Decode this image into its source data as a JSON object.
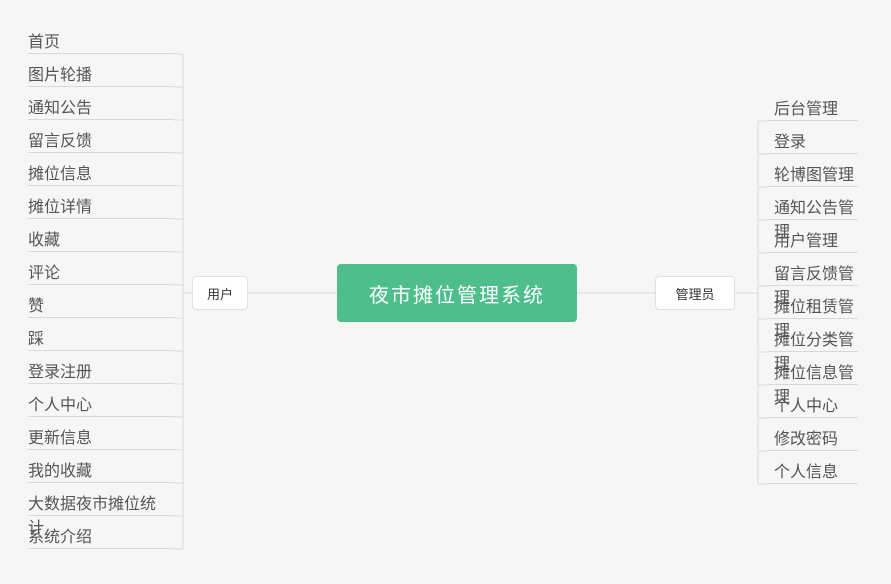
{
  "root": {
    "label": "夜市摊位管理系统"
  },
  "branches": {
    "left": {
      "label": "用户"
    },
    "right": {
      "label": "管理员"
    }
  },
  "leaves": {
    "left": [
      "首页",
      "图片轮播",
      "通知公告",
      "留言反馈",
      "摊位信息",
      "摊位详情",
      "收藏",
      "评论",
      "赞",
      "踩",
      "登录注册",
      "个人中心",
      "更新信息",
      "我的收藏",
      "大数据夜市摊位统计",
      "系统介绍"
    ],
    "right": [
      "后台管理",
      "登录",
      "轮博图管理",
      "通知公告管理",
      "用户管理",
      "留言反馈管理",
      "摊位租赁管理",
      "摊位分类管理",
      "摊位信息管理",
      "个人中心",
      "修改密码",
      "个人信息"
    ]
  },
  "chart_data": {
    "type": "mindmap",
    "root": "夜市摊位管理系统",
    "children": [
      {
        "label": "用户",
        "side": "left",
        "children": [
          "首页",
          "图片轮播",
          "通知公告",
          "留言反馈",
          "摊位信息",
          "摊位详情",
          "收藏",
          "评论",
          "赞",
          "踩",
          "登录注册",
          "个人中心",
          "更新信息",
          "我的收藏",
          "大数据夜市摊位统计",
          "系统介绍"
        ]
      },
      {
        "label": "管理员",
        "side": "right",
        "children": [
          "后台管理",
          "登录",
          "轮博图管理",
          "通知公告管理",
          "用户管理",
          "留言反馈管理",
          "摊位租赁管理",
          "摊位分类管理",
          "摊位信息管理",
          "个人中心",
          "修改密码",
          "个人信息"
        ]
      }
    ]
  },
  "colors": {
    "root_bg": "#4ebe8c",
    "line": "#d9d9d9"
  }
}
